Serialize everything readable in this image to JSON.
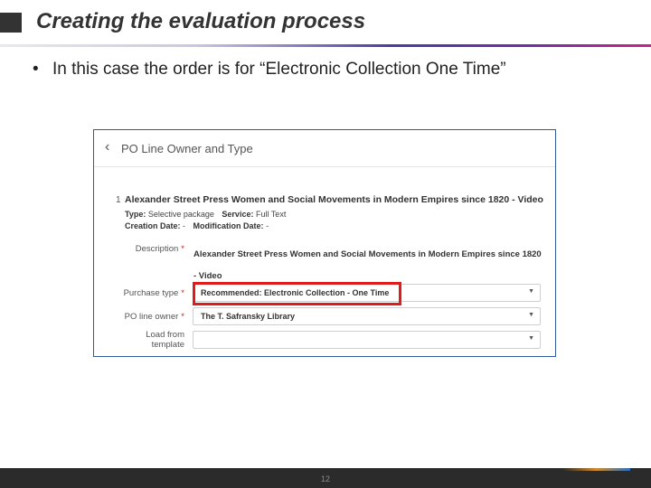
{
  "slide": {
    "title": "Creating the evaluation process",
    "bullet": "In this case the order is for “Electronic Collection One Time”",
    "page_number": "12"
  },
  "screenshot": {
    "header_title": "PO Line Owner and Type",
    "item": {
      "number": "1",
      "title": "Alexander Street Press Women and Social Movements in Modern Empires since 1820 - Video",
      "type_label": "Type:",
      "type_value": "Selective package",
      "service_label": "Service:",
      "service_value": "Full Text",
      "creation_label": "Creation Date:",
      "creation_value": "-",
      "modification_label": "Modification Date:",
      "modification_value": "-"
    },
    "fields": {
      "description_label": "Description",
      "description_value": "Alexander Street Press Women and Social Movements in Modern Empires since 1820 - Video",
      "purchase_type_label": "Purchase type",
      "purchase_type_value": "Recommended: Electronic Collection - One Time",
      "po_line_owner_label": "PO line owner",
      "po_line_owner_value": "The T. Safransky  Library",
      "load_from_template_label": "Load from template",
      "load_from_template_value": "",
      "required_marker": "*"
    }
  },
  "icons": {
    "back": "chevron-left-icon",
    "dropdown": "caret-down-icon"
  },
  "colors": {
    "highlight": "#e01b1b",
    "screenshot_border": "#2f5aa0",
    "required": "#cc2222"
  }
}
